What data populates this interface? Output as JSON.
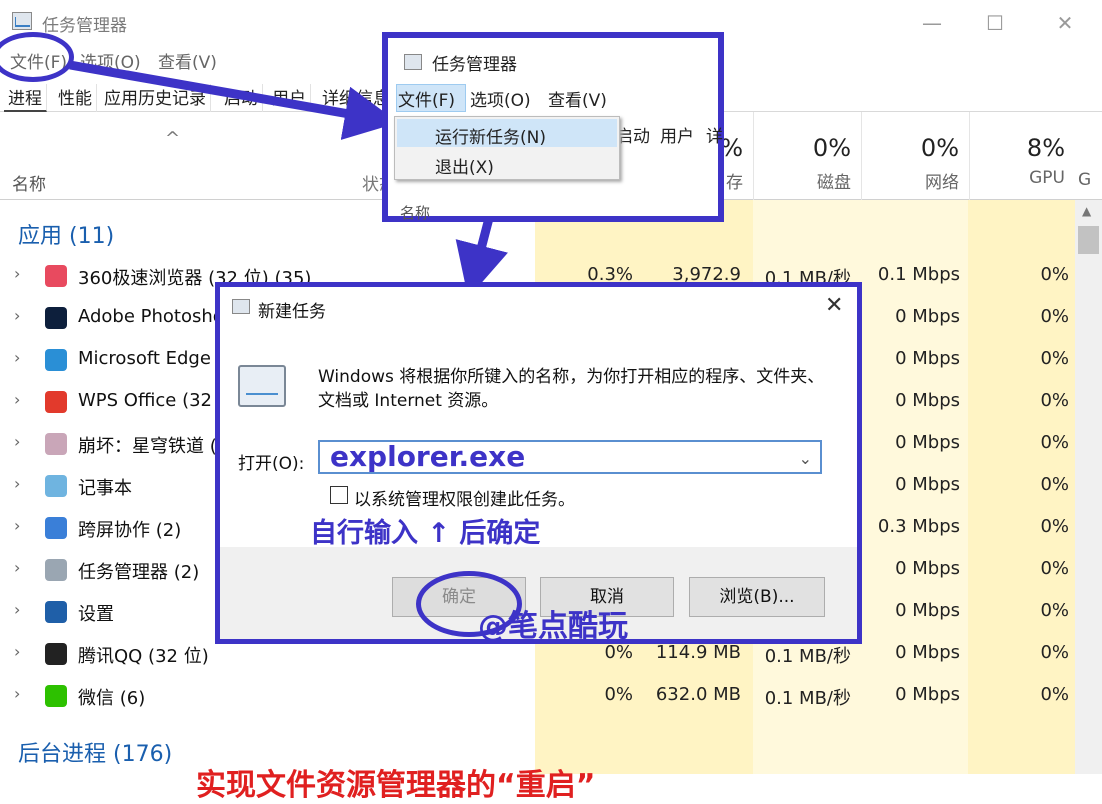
{
  "window": {
    "title": "任务管理器",
    "minimize": "—",
    "maximize": "☐",
    "close": "✕"
  },
  "menubar": [
    "文件(F)",
    "选项(O)",
    "查看(V)"
  ],
  "tabs": [
    "进程",
    "性能",
    "应用历史记录",
    "启动",
    "用户",
    "详细信息"
  ],
  "columns": {
    "sort_caret": "^",
    "name": "名称",
    "status": "状态",
    "cpu": {
      "pct": "",
      "label": ""
    },
    "memory": {
      "pct": "%",
      "label": "存"
    },
    "disk": {
      "pct": "0%",
      "label": "磁盘"
    },
    "network": {
      "pct": "0%",
      "label": "网络"
    },
    "gpu": {
      "pct": "8%",
      "label": "GPU"
    },
    "gpu_engine": "G"
  },
  "group_apps": "应用 (11)",
  "group_bg": "后台进程 (176)",
  "rows": [
    {
      "name": "360极速浏览器 (32 位) (35)",
      "icon_color": "#e84a5f",
      "icon": "browser-360-icon",
      "cpu": "0.3%",
      "mem": "3,972.9",
      "disk": "0.1 MB/秒",
      "net": "0.1 Mbps",
      "gpu": "0%"
    },
    {
      "name": "Adobe Photoshop",
      "icon_color": "#0d1f3c",
      "icon": "photoshop-icon",
      "cpu": "",
      "mem": "",
      "disk": "",
      "net": "0 Mbps",
      "gpu": "0%"
    },
    {
      "name": "Microsoft Edge",
      "icon_color": "#2a8fd6",
      "icon": "edge-icon",
      "cpu": "",
      "mem": "",
      "disk": "",
      "net": "0 Mbps",
      "gpu": "0%"
    },
    {
      "name": "WPS Office (32",
      "icon_color": "#e23a2c",
      "icon": "wps-icon",
      "cpu": "",
      "mem": "",
      "disk": "",
      "net": "0 Mbps",
      "gpu": "0%"
    },
    {
      "name": "崩坏：星穹铁道 (",
      "icon_color": "#c9a6b8",
      "icon": "starrail-icon",
      "cpu": "",
      "mem": "",
      "disk": "",
      "net": "0 Mbps",
      "gpu": "0%"
    },
    {
      "name": "记事本",
      "icon_color": "#6fb4e0",
      "icon": "notepad-icon",
      "cpu": "",
      "mem": "",
      "disk": "",
      "net": "0 Mbps",
      "gpu": "0%"
    },
    {
      "name": "跨屏协作 (2)",
      "icon_color": "#3a7fd8",
      "icon": "phone-link-icon",
      "cpu": "",
      "mem": "",
      "disk": "",
      "net": "0.3 Mbps",
      "gpu": "0%"
    },
    {
      "name": "任务管理器 (2)",
      "icon_color": "#9aa6b2",
      "icon": "task-manager-icon",
      "cpu": "",
      "mem": "",
      "disk": "",
      "net": "0 Mbps",
      "gpu": "0%"
    },
    {
      "name": "设置",
      "icon_color": "#1f5fa8",
      "icon": "settings-gear-icon",
      "cpu": "",
      "mem": "",
      "disk": "",
      "net": "0 Mbps",
      "gpu": "0%"
    },
    {
      "name": "腾讯QQ (32 位)",
      "icon_color": "#222222",
      "icon": "qq-penguin-icon",
      "cpu": "0%",
      "mem": "114.9 MB",
      "disk": "0.1 MB/秒",
      "net": "0 Mbps",
      "gpu": "0%"
    },
    {
      "name": "微信 (6)",
      "icon_color": "#2dc100",
      "icon": "wechat-icon",
      "cpu": "0%",
      "mem": "632.0 MB",
      "disk": "0.1 MB/秒",
      "net": "0 Mbps",
      "gpu": "0%"
    }
  ],
  "popup": {
    "title": "任务管理器",
    "menus": [
      "文件(F)",
      "选项(O)",
      "查看(V)"
    ],
    "dropdown": [
      "运行新任务(N)",
      "退出(X)"
    ],
    "behind_tabs": [
      "启动",
      "用户",
      "详"
    ],
    "behind_col": "名称"
  },
  "dialog": {
    "title": "新建任务",
    "message": "Windows 将根据你所键入的名称，为你打开相应的程序、文件夹、文档或 Internet 资源。",
    "open_label": "打开(O):",
    "open_value": "explorer.exe",
    "checkbox_label": "以系统管理权限创建此任务。",
    "annotation": "自行输入 ↑ 后确定",
    "ok": "确定",
    "cancel": "取消",
    "browse": "浏览(B)...",
    "watermark": "@笔点酷玩"
  },
  "bottom_caption": "实现文件资源管理器的“重启”",
  "colors": {
    "annotation": "#3d33c7",
    "caption": "#e02020",
    "highlight": "#fff4c4"
  }
}
